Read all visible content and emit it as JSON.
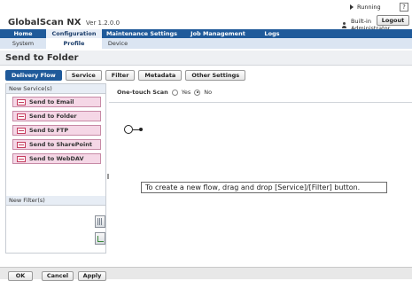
{
  "header": {
    "brand": "GlobalScan NX",
    "version": "Ver 1.2.0.0",
    "status": "Running",
    "user": "Built-in Administrator",
    "logout_label": "Logout",
    "help_label": "?"
  },
  "main_nav": [
    {
      "label": "Home",
      "active": false
    },
    {
      "label": "Configuration",
      "active": true
    },
    {
      "label": "Maintenance Settings",
      "active": false
    },
    {
      "label": "Job Management",
      "active": false
    },
    {
      "label": "Logs",
      "active": false
    }
  ],
  "sub_nav": [
    {
      "label": "System",
      "active": false
    },
    {
      "label": "Profile",
      "active": true
    },
    {
      "label": "Device",
      "active": false
    }
  ],
  "page": {
    "title": "Send to Folder",
    "tabs": [
      {
        "label": "Delivery Flow",
        "active": true
      },
      {
        "label": "Service",
        "active": false
      },
      {
        "label": "Filter",
        "active": false
      },
      {
        "label": "Metadata",
        "active": false
      },
      {
        "label": "Other Settings",
        "active": false
      }
    ]
  },
  "left_panel": {
    "new_service_header": "New Service(s)",
    "services": [
      "Send to Email",
      "Send to Folder",
      "Send to FTP",
      "Send to SharePoint",
      "Send to WebDAV"
    ],
    "new_filter_header": "New Filter(s)"
  },
  "canvas": {
    "one_touch_label": "One-touch Scan",
    "one_touch_yes": "Yes",
    "one_touch_no": "No",
    "one_touch_selected": "No",
    "hint": "To create a new flow, drag and drop [Service]/[Filter] button."
  },
  "footer": {
    "ok": "OK",
    "cancel": "Cancel",
    "apply": "Apply"
  },
  "colors": {
    "nav_blue": "#1f5a9a",
    "service_pink": "#f5d7e6",
    "service_icon_red": "#c43b5d"
  }
}
